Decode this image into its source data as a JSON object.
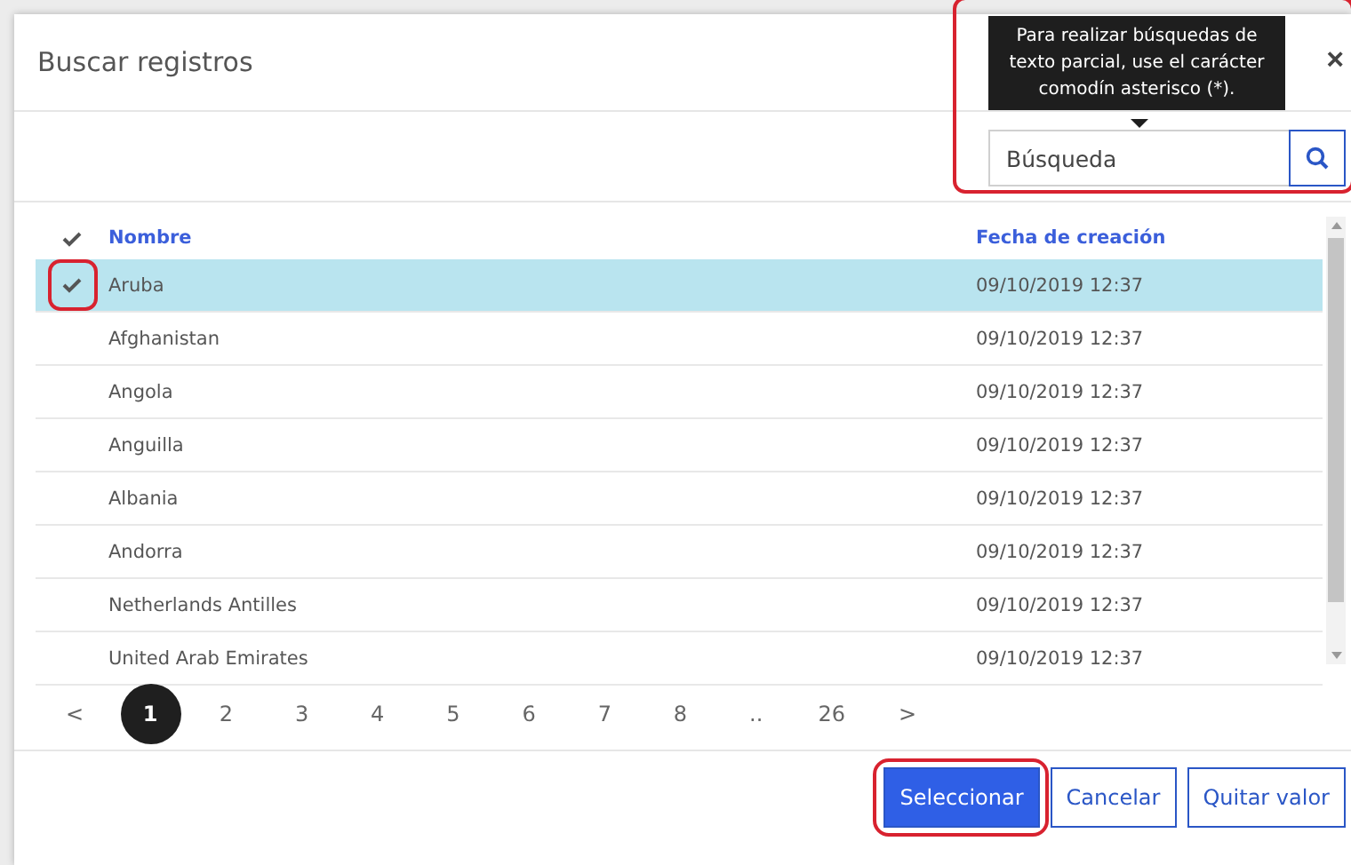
{
  "dialog": {
    "title": "Buscar registros",
    "close": "×"
  },
  "search": {
    "placeholder": "Búsqueda",
    "tooltip": "Para realizar búsquedas de texto parcial, use el carácter comodín asterisco (*).",
    "highlighted": true
  },
  "table": {
    "columns": [
      "Nombre",
      "Fecha de creación"
    ],
    "rows": [
      {
        "name": "Aruba",
        "date": "09/10/2019 12:37",
        "selected": true,
        "highlighted": true
      },
      {
        "name": "Afghanistan",
        "date": "09/10/2019 12:37",
        "selected": false,
        "highlighted": false
      },
      {
        "name": "Angola",
        "date": "09/10/2019 12:37",
        "selected": false,
        "highlighted": false
      },
      {
        "name": "Anguilla",
        "date": "09/10/2019 12:37",
        "selected": false,
        "highlighted": false
      },
      {
        "name": "Albania",
        "date": "09/10/2019 12:37",
        "selected": false,
        "highlighted": false
      },
      {
        "name": "Andorra",
        "date": "09/10/2019 12:37",
        "selected": false,
        "highlighted": false
      },
      {
        "name": "Netherlands Antilles",
        "date": "09/10/2019 12:37",
        "selected": false,
        "highlighted": false
      },
      {
        "name": "United Arab Emirates",
        "date": "09/10/2019 12:37",
        "selected": false,
        "highlighted": false
      }
    ]
  },
  "pagination": {
    "prev": "<",
    "next": ">",
    "pages": [
      {
        "label": "1",
        "selected": true
      },
      {
        "label": "2",
        "selected": false
      },
      {
        "label": "3",
        "selected": false
      },
      {
        "label": "4",
        "selected": false
      },
      {
        "label": "5",
        "selected": false
      },
      {
        "label": "6",
        "selected": false
      },
      {
        "label": "7",
        "selected": false
      },
      {
        "label": "8",
        "selected": false
      },
      {
        "label": "..",
        "selected": false
      },
      {
        "label": "26",
        "selected": false
      }
    ]
  },
  "buttons": [
    {
      "label": "Seleccionar",
      "kind": "primary",
      "highlighted": true
    },
    {
      "label": "Cancelar",
      "kind": "secondary",
      "highlighted": false
    },
    {
      "label": "Quitar valor",
      "kind": "secondary",
      "highlighted": false
    }
  ]
}
